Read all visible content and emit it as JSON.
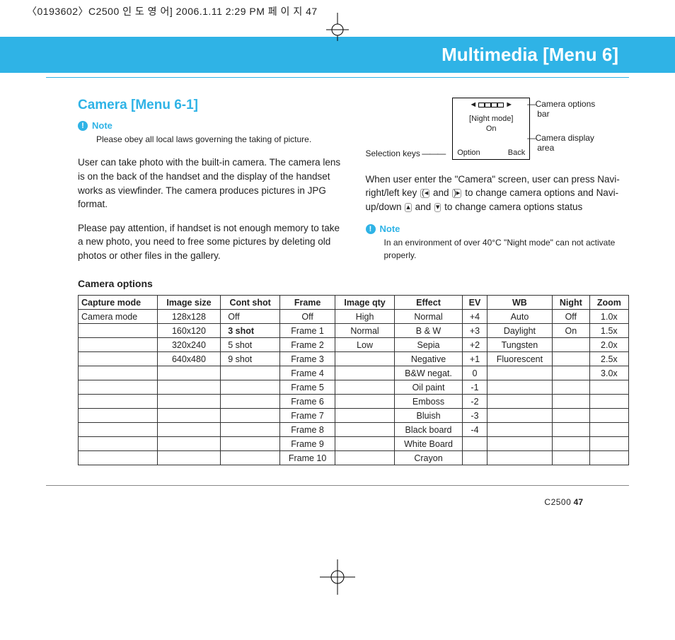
{
  "printHeader": "〈0193602〉C2500 인 도 영 어]  2006.1.11 2:29 PM  페 이 지 47",
  "titleBar": "Multimedia [Menu 6]",
  "section": "Camera [Menu 6-1]",
  "noteLabel": "Note",
  "note1": "Please obey all local laws governing the taking of picture.",
  "para1": "User can take photo with the built-in camera. The camera lens is on the back of the handset and the display of the handset works as viewfinder. The camera produces pictures in JPG format.",
  "para2": "Please pay attention, if handset is not enough memory to take a new photo, you need to free some pictures by deleting old photos or other files in the gallery.",
  "subhead": "Camera options",
  "diagram": {
    "selectionKeys": "Selection keys",
    "nightMode": "[Night mode]",
    "on": "On",
    "option": "Option",
    "back": "Back",
    "calloutBar": "Camera options bar",
    "calloutArea": "Camera display area"
  },
  "para3a": "When user enter the \"Camera\" screen, user can press Navi-right/left key ",
  "para3b": " and ",
  "para3c": " to change camera options and Navi-up/down ",
  "para3d": " and ",
  "para3e": " to change camera options status",
  "note2": "In an environment of over 40°C \"Night mode\" can not activate properly.",
  "headers": [
    "Capture mode",
    "Image size",
    "Cont shot",
    "Frame",
    "Image qty",
    "Effect",
    "EV",
    "WB",
    "Night",
    "Zoom"
  ],
  "rows": [
    [
      "Camera mode",
      "128x128",
      "Off",
      "Off",
      "High",
      "Normal",
      "+4",
      "Auto",
      "Off",
      "1.0x"
    ],
    [
      "",
      "160x120",
      "3 shot",
      "Frame 1",
      "Normal",
      "B & W",
      "+3",
      "Daylight",
      "On",
      "1.5x"
    ],
    [
      "",
      "320x240",
      "5 shot",
      "Frame 2",
      "Low",
      "Sepia",
      "+2",
      "Tungsten",
      "",
      "2.0x"
    ],
    [
      "",
      "640x480",
      "9 shot",
      "Frame 3",
      "",
      "Negative",
      "+1",
      "Fluorescent",
      "",
      "2.5x"
    ],
    [
      "",
      "",
      "",
      "Frame 4",
      "",
      "B&W negat.",
      "0",
      "",
      "",
      "3.0x"
    ],
    [
      "",
      "",
      "",
      "Frame 5",
      "",
      "Oil paint",
      "-1",
      "",
      "",
      ""
    ],
    [
      "",
      "",
      "",
      "Frame 6",
      "",
      "Emboss",
      "-2",
      "",
      "",
      ""
    ],
    [
      "",
      "",
      "",
      "Frame 7",
      "",
      "Bluish",
      "-3",
      "",
      "",
      ""
    ],
    [
      "",
      "",
      "",
      "Frame 8",
      "",
      "Black board",
      "-4",
      "",
      "",
      ""
    ],
    [
      "",
      "",
      "",
      "Frame 9",
      "",
      "White Board",
      "",
      "",
      "",
      ""
    ],
    [
      "",
      "",
      "",
      "Frame 10",
      "",
      "Crayon",
      "",
      "",
      "",
      ""
    ]
  ],
  "boldCells": [
    [
      1,
      2
    ]
  ],
  "footerModel": "C2500",
  "footerPage": "47"
}
